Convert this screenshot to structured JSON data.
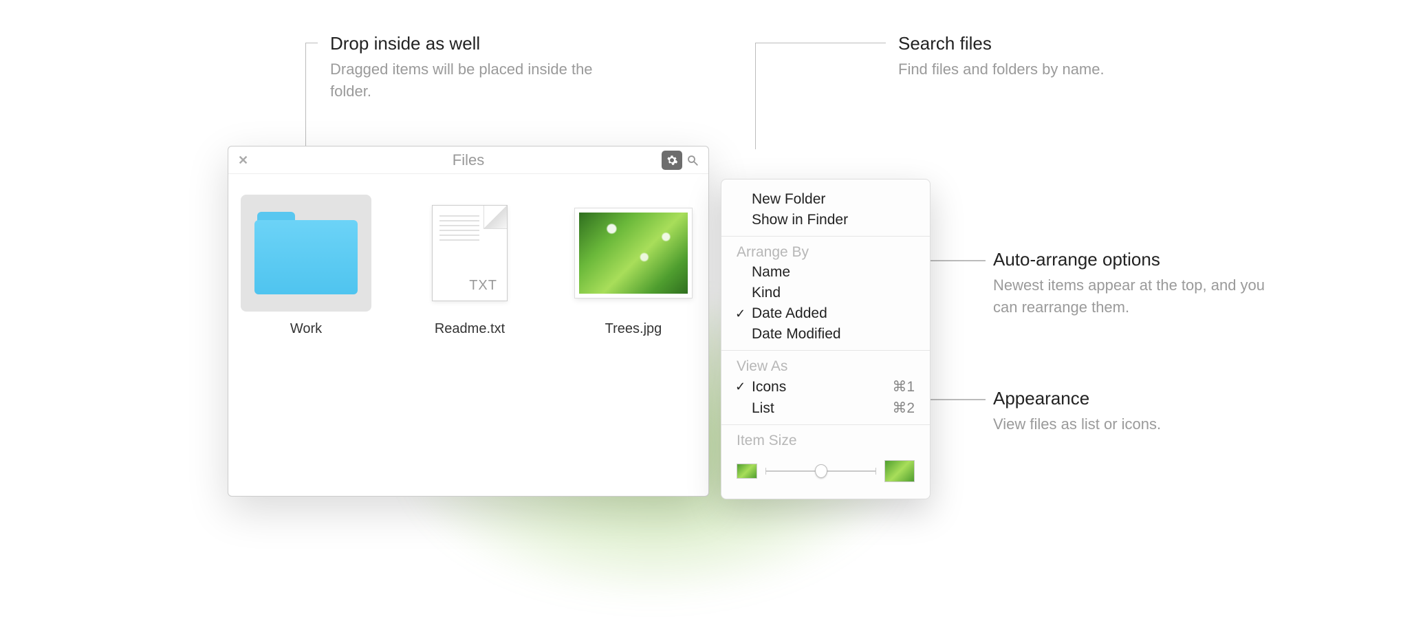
{
  "annotations": {
    "drop": {
      "title": "Drop inside as well",
      "desc": "Dragged items will be placed inside the folder."
    },
    "search": {
      "title": "Search files",
      "desc": "Find files and folders by name."
    },
    "arrange": {
      "title": "Auto-arrange options",
      "desc": "Newest items appear at the top, and you can rearrange them."
    },
    "appearance": {
      "title": "Appearance",
      "desc": "View files as list or icons."
    }
  },
  "window": {
    "title": "Files",
    "items": [
      {
        "label": "Work",
        "kind": "folder",
        "selected": true
      },
      {
        "label": "Readme.txt",
        "kind": "txt",
        "ext": "TXT"
      },
      {
        "label": "Trees.jpg",
        "kind": "image"
      }
    ]
  },
  "menu": {
    "actions": {
      "new_folder": "New Folder",
      "show_in_finder": "Show in Finder"
    },
    "arrange_label": "Arrange By",
    "arrange": {
      "name": "Name",
      "kind": "Kind",
      "date_added": "Date Added",
      "date_modified": "Date Modified"
    },
    "arrange_selected": "date_added",
    "view_label": "View As",
    "view": {
      "icons": {
        "label": "Icons",
        "shortcut": "⌘1"
      },
      "list": {
        "label": "List",
        "shortcut": "⌘2"
      }
    },
    "view_selected": "icons",
    "item_size_label": "Item Size"
  }
}
